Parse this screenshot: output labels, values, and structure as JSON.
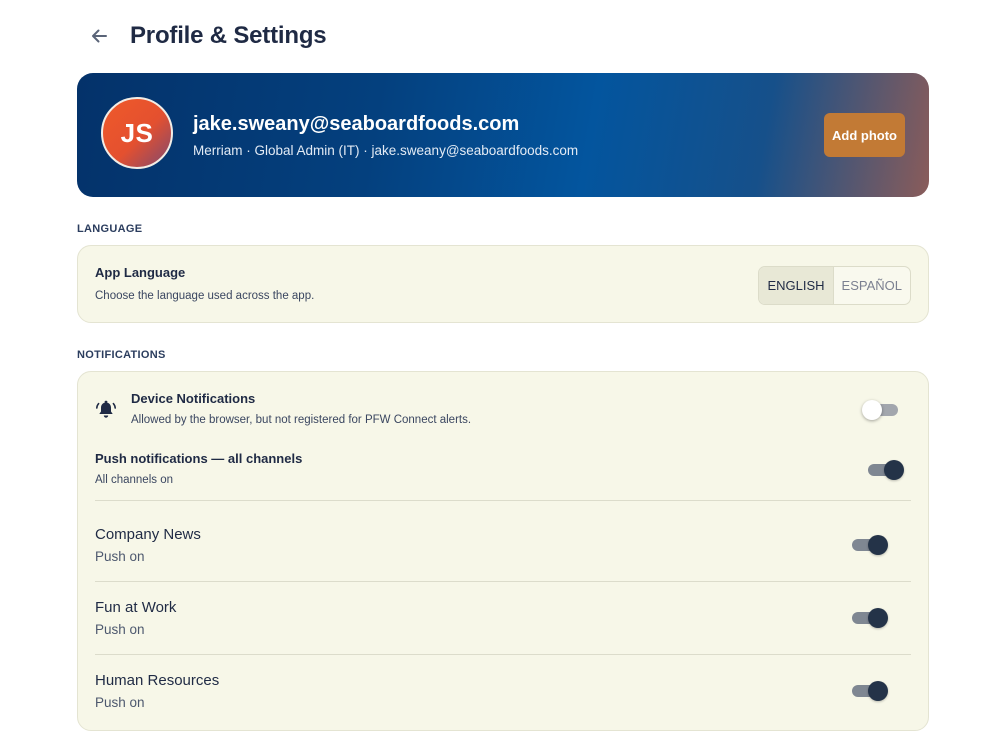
{
  "header": {
    "title": "Profile & Settings",
    "back_icon": "arrow-left-icon"
  },
  "profile": {
    "initials": "JS",
    "email": "jake.sweany@seaboardfoods.com",
    "meta": "Merriam · Global Admin (IT) · jake.sweany@seaboardfoods.com",
    "add_photo_label": "Add photo"
  },
  "language": {
    "section_label": "LANGUAGE",
    "title": "App Language",
    "description": "Choose the language used across the app.",
    "options": [
      "ENGLISH",
      "ESPAÑOL"
    ],
    "selected": "ENGLISH"
  },
  "notifications": {
    "section_label": "NOTIFICATIONS",
    "device": {
      "icon": "bell-icon",
      "title": "Device Notifications",
      "subtitle": "Allowed by the browser, but not registered for PFW Connect alerts.",
      "enabled": false
    },
    "push_all": {
      "title": "Push notifications — all channels",
      "subtitle": "All channels on",
      "enabled": true
    },
    "channels": [
      {
        "name": "Company News",
        "status": "Push on",
        "enabled": true
      },
      {
        "name": "Fun at Work",
        "status": "Push on",
        "enabled": true
      },
      {
        "name": "Human Resources",
        "status": "Push on",
        "enabled": true
      }
    ]
  },
  "colors": {
    "hero_start": "#04326a",
    "accent_button": "#c27a35",
    "card_bg": "#f7f7e8",
    "toggle_knob_on": "#243348"
  }
}
